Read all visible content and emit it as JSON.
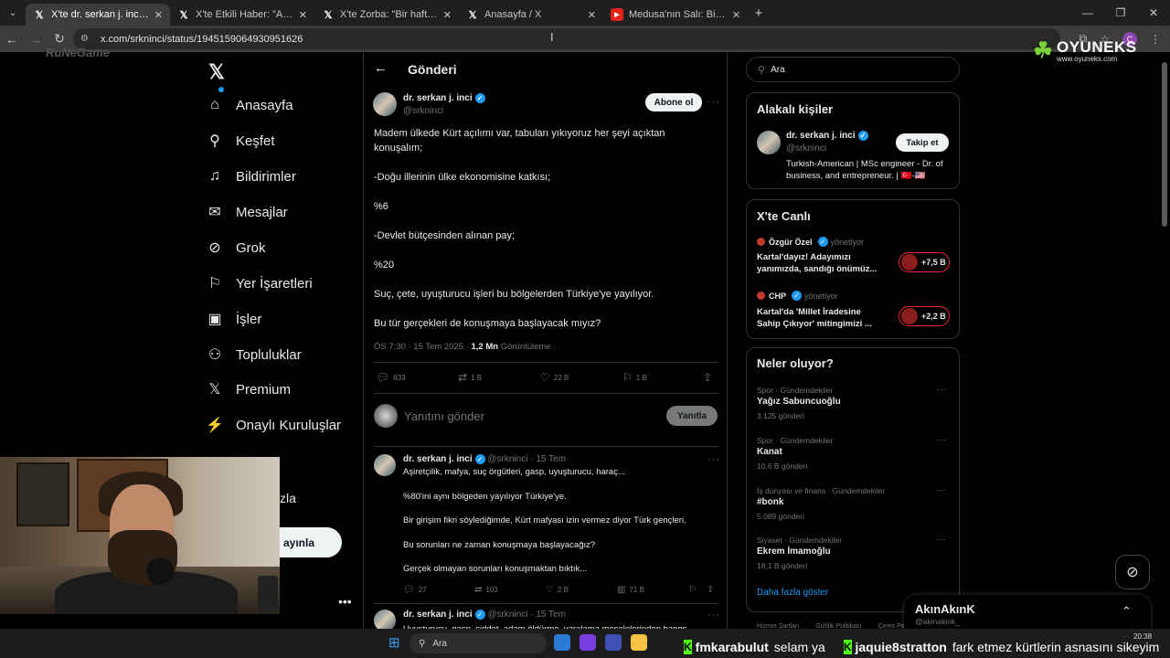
{
  "browser": {
    "tabs": [
      {
        "title": "X'te dr. serkan j. inci: \"Madem ülkede Kürt açılımı var",
        "icon": "x-logo",
        "active": true
      },
      {
        "title": "X'te Etkili Haber: \"AKP'li Abdurrahim",
        "icon": "x-logo",
        "active": false
      },
      {
        "title": "X'te Zorba: \"Bir haftadır Türkiye",
        "icon": "x-logo",
        "active": false
      },
      {
        "title": "Anasayfa / X",
        "icon": "x-logo",
        "active": false
      },
      {
        "title": "Medusa'nın Salı: Bir AKP Belgeseli",
        "icon": "youtube-logo",
        "active": false
      }
    ],
    "url": "x.com/srkninci/status/1945159064930951626",
    "profile_letter": "C"
  },
  "overlay": {
    "brand": "OYUNEKS",
    "brand_url": "www.oyuneks.com",
    "watermark": "RuNeGame"
  },
  "nav": {
    "items": [
      {
        "label": "Anasayfa",
        "icon": "home-icon"
      },
      {
        "label": "Keşfet",
        "icon": "search-icon"
      },
      {
        "label": "Bildirimler",
        "icon": "bell-icon"
      },
      {
        "label": "Mesajlar",
        "icon": "mail-icon"
      },
      {
        "label": "Grok",
        "icon": "grok-icon"
      },
      {
        "label": "Yer İşaretleri",
        "icon": "bookmark-icon"
      },
      {
        "label": "İşler",
        "icon": "briefcase-icon"
      },
      {
        "label": "Topluluklar",
        "icon": "people-icon"
      },
      {
        "label": "Premium",
        "icon": "x-logo-icon"
      },
      {
        "label": "Onaylı Kuruluşlar",
        "icon": "lightning-icon"
      }
    ],
    "partial_label": "zla",
    "post_button": "ayınla"
  },
  "post": {
    "header": "Gönderi",
    "author": "dr. serkan j. inci",
    "handle": "@srkninci",
    "follow": "Abone ol",
    "lines": [
      "Madem ülkede Kürt açılımı var, tabuları yıkıyoruz her şeyi açıktan",
      "konuşalım;",
      "-Doğu illerinin ülke ekonomisine katkısı;",
      "%6",
      "-Devlet bütçesinden alınan pay;",
      "%20",
      "Suç, çete, uyuşturucu işleri bu bölgelerden Türkiye'ye yayılıyor.",
      "Bu tür gerçekleri de konuşmaya başlayacak mıyız?"
    ],
    "time": "ÖS 7:30 · 15 Tem 2025 · ",
    "views": "1,2 Mn",
    "views_label": " Görüntüleme",
    "stats": {
      "replies": "833",
      "reposts": "1 B",
      "likes": "22 B",
      "bookmarks": "1 B"
    },
    "reply_placeholder": "Yanıtını gönder",
    "reply_button": "Yanıtla"
  },
  "replies": [
    {
      "author": "dr. serkan j. inci",
      "handle": "@srkninci",
      "date": "15 Tem",
      "lines": [
        "Aşiretçilik, mafya, suç örgütleri, gasp, uyuşturucu, haraç...",
        "%80'ini aynı bölgeden yayılıyor Türkiye'ye.",
        "Bir girişim fikri söylediğimde, Kürt mafyası izin vermez diyor Türk gençleri.",
        "Bu sorunları ne zaman konuşmaya başlayacağız?",
        "Gerçek olmayan sorunları konuşmaktan bıktık..."
      ],
      "stats": {
        "replies": "27",
        "reposts": "103",
        "likes": "2 B",
        "views": "71 B"
      }
    },
    {
      "author": "dr. serkan j. inci",
      "handle": "@srkninci",
      "date": "15 Tem",
      "lines": [
        "Uyuşturucu, gasp, şiddet, adam öldürme, yaralama meselelerinden hangs"
      ]
    }
  ],
  "sidebar": {
    "search_placeholder": "Ara",
    "relevant": {
      "title": "Alakalı kişiler",
      "name": "dr. serkan j. inci",
      "handle": "@srkninci",
      "bio": "Turkish-American | MSc engineer - Dr. of business, and entrepreneur. | 🇹🇷-🇺🇸",
      "button": "Takip et"
    },
    "live": {
      "title": "X'te Canlı",
      "items": [
        {
          "host": "Özgür Özel",
          "role": "yönetiyor",
          "title": "Kartal'dayız! Adayımızı yanımızda, sandığı önümüz...",
          "count": "+7,5 B"
        },
        {
          "host": "CHP",
          "role": "yönetiyor",
          "title": "Kartal'da 'Millet İradesine Sahip Çıkıyor' mitingimizi ...",
          "count": "+2,2 B"
        }
      ]
    },
    "trends": {
      "title": "Neler oluyor?",
      "items": [
        {
          "category": "Spor · Gündemdekiler",
          "name": "Yağız Sabuncuoğlu",
          "count": "3.125 gönderi"
        },
        {
          "category": "Spor · Gündemdekiler",
          "name": "Kanat",
          "count": "10,6 B gönderi"
        },
        {
          "category": "İş dünyası ve finans · Gündemdekiler",
          "name": "#bonk",
          "count": "5.089 gönderi"
        },
        {
          "category": "Siyaset · Gündemdekiler",
          "name": "Ekrem İmamoğlu",
          "count": "18,1 B gönderi"
        }
      ],
      "more": "Daha fazla göster"
    },
    "footer": [
      "Hizmet Şartları",
      "Gizlilik Politikası",
      "Çerez Po"
    ]
  },
  "messages": {
    "name": "AkınAkınK",
    "handle": "@akinakink_"
  },
  "taskbar": {
    "search": "Ara",
    "time": "20:38"
  },
  "ticker": [
    {
      "user": "fmkarabulut",
      "msg": "selam ya"
    },
    {
      "user": "jaquie8stratton",
      "msg": "fark etmez kürtlerin asnasını sikeyim"
    }
  ]
}
